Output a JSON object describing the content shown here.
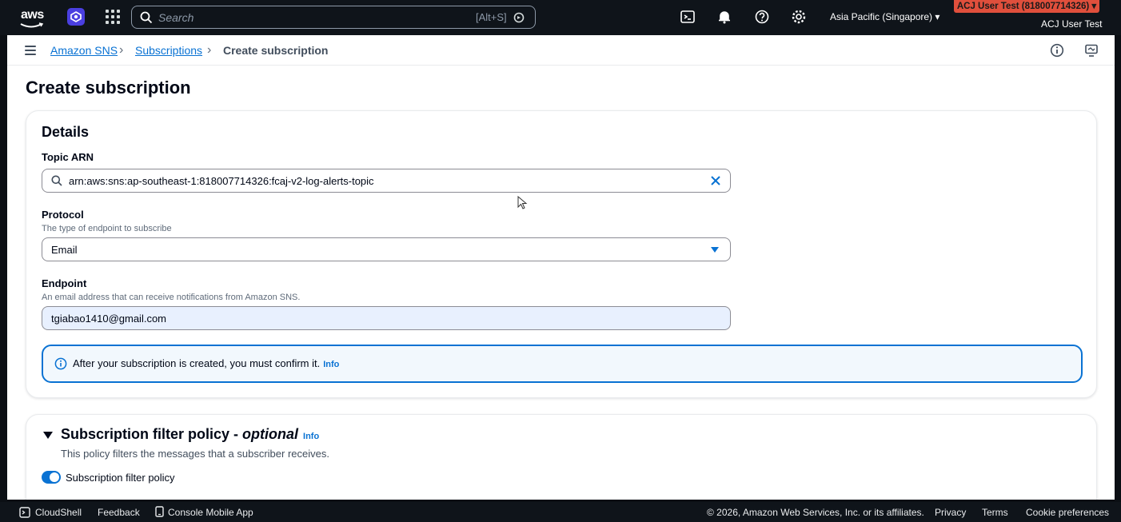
{
  "topbar": {
    "logo_text": "aws",
    "search_placeholder": "Search",
    "search_shortcut": "[Alt+S]",
    "region": "Asia Pacific (Singapore) ▾",
    "account_badge": "ACJ User Test (818007714326) ▾",
    "account_user": "ACJ User Test"
  },
  "breadcrumb": {
    "items": [
      "Amazon SNS",
      "Subscriptions"
    ],
    "current": "Create subscription"
  },
  "page": {
    "title": "Create subscription"
  },
  "details": {
    "title": "Details",
    "topic_arn_label": "Topic ARN",
    "topic_arn_value": "arn:aws:sns:ap-southeast-1:818007714326:fcaj-v2-log-alerts-topic",
    "protocol_label": "Protocol",
    "protocol_desc": "The type of endpoint to subscribe",
    "protocol_value": "Email",
    "endpoint_label": "Endpoint",
    "endpoint_desc": "An email address that can receive notifications from Amazon SNS.",
    "endpoint_value": "tgiabao1410@gmail.com",
    "alert_text": "After your subscription is created, you must confirm it.",
    "alert_link": "Info"
  },
  "filter_policy": {
    "title_main": "Subscription filter policy - ",
    "title_optional": "optional",
    "info_link": "Info",
    "desc": "This policy filters the messages that a subscriber receives.",
    "toggle_label": "Subscription filter policy",
    "toggle_on": true
  },
  "footer": {
    "cloudshell": "CloudShell",
    "feedback": "Feedback",
    "mobile_app": "Console Mobile App",
    "copyright": "© 2026, Amazon Web Services, Inc. or its affiliates.",
    "privacy": "Privacy",
    "terms": "Terms",
    "cookies": "Cookie preferences"
  },
  "colors": {
    "link": "#0972d3",
    "topbar_bg": "#0f141a",
    "account_badge": "#e04f3c"
  }
}
